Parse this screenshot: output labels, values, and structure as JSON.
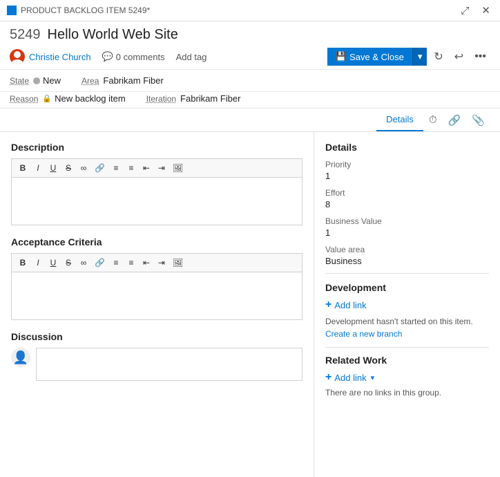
{
  "titleBar": {
    "icon": "backlog-icon",
    "label": "PRODUCT BACKLOG ITEM 5249*",
    "expandBtn": "⤢",
    "closeBtn": "✕"
  },
  "header": {
    "itemId": "5249",
    "itemTitle": "Hello World Web Site",
    "user": "Christie Church",
    "commentsCount": "0 comments",
    "addTagLabel": "Add tag",
    "saveCloseLabel": "Save & Close",
    "saveIcon": "💾"
  },
  "fields": {
    "stateLabel": "State",
    "stateValue": "New",
    "reasonLabel": "Reason",
    "reasonValue": "New backlog item",
    "areaLabel": "Area",
    "areaValue": "Fabrikam Fiber",
    "iterationLabel": "Iteration",
    "iterationValue": "Fabrikam Fiber"
  },
  "tabs": {
    "details": "Details",
    "historyIcon": "⏱",
    "linkIcon": "🔗",
    "attachIcon": "📎"
  },
  "description": {
    "sectionTitle": "Description",
    "toolbarItems": [
      "B",
      "I",
      "U",
      "S",
      "∞",
      "🔗",
      "≡",
      "≡",
      "⇤",
      "⇥",
      "🖼"
    ]
  },
  "acceptanceCriteria": {
    "sectionTitle": "Acceptance Criteria",
    "toolbarItems": [
      "B",
      "I",
      "U",
      "S",
      "∞",
      "🔗",
      "≡",
      "≡",
      "⇤",
      "⇥",
      "🖼"
    ]
  },
  "discussion": {
    "sectionTitle": "Discussion"
  },
  "details": {
    "panelTitle": "Details",
    "priorityLabel": "Priority",
    "priorityValue": "1",
    "effortLabel": "Effort",
    "effortValue": "8",
    "businessValueLabel": "Business Value",
    "businessValueValue": "1",
    "valueAreaLabel": "Value area",
    "valueAreaValue": "Business"
  },
  "development": {
    "sectionTitle": "Development",
    "addLinkLabel": "Add link",
    "noteText": "Development hasn't started on this item.",
    "branchLinkText": "Create a new branch"
  },
  "relatedWork": {
    "sectionTitle": "Related Work",
    "addLinkLabel": "Add link",
    "noLinksText": "There are no links in this group."
  }
}
